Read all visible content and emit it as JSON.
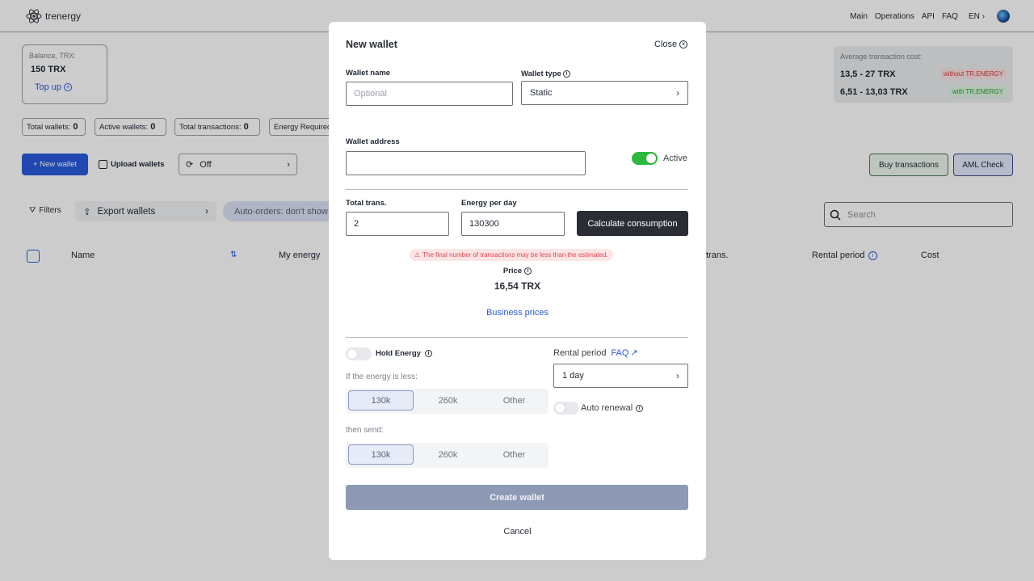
{
  "topbar": {
    "brand": "trenergy",
    "nav": [
      "Main",
      "Operations",
      "API",
      "FAQ"
    ],
    "lang": "EN"
  },
  "balance": {
    "label": "Balance, TRX:",
    "value": "150 TRX",
    "topup": "Top up"
  },
  "stats": [
    {
      "label": "Total wallets:",
      "value": "0"
    },
    {
      "label": "Active wallets:",
      "value": "0"
    },
    {
      "label": "Total transactions:",
      "value": "0"
    },
    {
      "label": "Energy Required",
      "value": ""
    }
  ],
  "actions": {
    "new_wallet": "+ New wallet",
    "upload": "Upload wallets",
    "off": "Off"
  },
  "filters": {
    "filters": "Filters",
    "export": "Export wallets",
    "autoorders": "Auto-orders: don't show"
  },
  "table": {
    "headers": {
      "name": "Name",
      "my_energy": "My energy",
      "trans": "trans.",
      "rental_period": "Rental period",
      "cost": "Cost"
    }
  },
  "avg_cost": {
    "label": "Average transaction cost:",
    "rows": [
      {
        "value": "13,5 - 27 TRX",
        "tag": "without TR.ENERGY"
      },
      {
        "value": "6,51 - 13,03 TRX",
        "tag": "with TR.ENERGY"
      }
    ]
  },
  "right_actions": {
    "buy": "Buy transactions",
    "aml": "AML Check",
    "search_placeholder": "Search"
  },
  "modal": {
    "title": "New wallet",
    "close": "Close",
    "wallet_name": {
      "label": "Wallet name",
      "placeholder": "Optional"
    },
    "wallet_type": {
      "label": "Wallet type",
      "value": "Static"
    },
    "wallet_address": {
      "label": "Wallet address",
      "value": ""
    },
    "active": {
      "label": "Active",
      "on": true
    },
    "total_trans": {
      "label": "Total trans.",
      "value": "2"
    },
    "energy_per_day": {
      "label": "Energy per day",
      "value": "130300"
    },
    "calculate": "Calculate consumption",
    "warning": "The final number of transactions may be less than the estimated.",
    "price": {
      "label": "Price",
      "value": "16,54 TRX"
    },
    "business_prices": "Business prices",
    "hold_energy": {
      "label": "Hold Energy",
      "on": false
    },
    "if_less": "If the energy is less:",
    "if_less_options": [
      "130k",
      "260k",
      "Other"
    ],
    "then_send": "then send:",
    "then_send_options": [
      "130k",
      "260k",
      "Other"
    ],
    "rental_period": {
      "label": "Rental period",
      "faq": "FAQ",
      "value": "1 day"
    },
    "auto_renewal": {
      "label": "Auto renewal",
      "on": false
    },
    "create": "Create wallet",
    "cancel": "Cancel"
  },
  "colors": {
    "accent": "#2a5bdc",
    "toggle_on": "#2fb93c",
    "create_disabled": "#8e99b5",
    "dark_button": "#2a2d33"
  }
}
